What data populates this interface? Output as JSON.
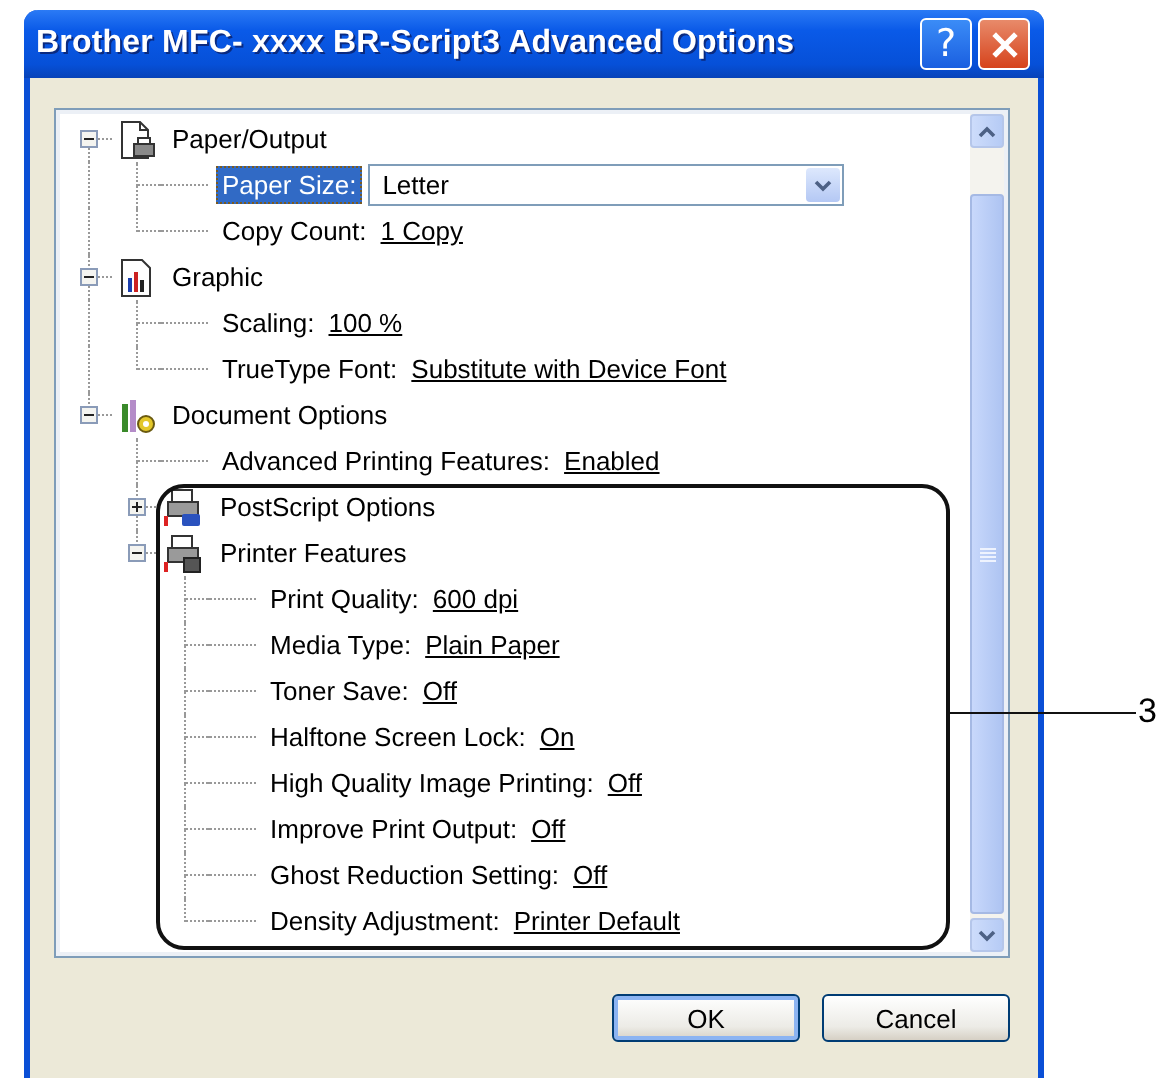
{
  "window": {
    "title": "Brother MFC- xxxx BR-Script3 Advanced Options",
    "help_button": "?"
  },
  "tree": [
    {
      "kind": "paper",
      "label": "Paper/Output",
      "expanded": true,
      "children": [
        {
          "kind": "dropdown",
          "label": "Paper Size:",
          "value": "Letter",
          "selected": true
        },
        {
          "kind": "setting",
          "label": "Copy Count:",
          "value": "1 Copy",
          "selected": false
        }
      ]
    },
    {
      "kind": "chart",
      "label": "Graphic",
      "expanded": true,
      "children": [
        {
          "kind": "setting",
          "label": "Scaling:",
          "value": "100 %",
          "selected": false
        },
        {
          "kind": "setting",
          "label": "TrueType Font:",
          "value": "Substitute with Device Font",
          "selected": false
        }
      ]
    },
    {
      "kind": "tools",
      "label": "Document Options",
      "expanded": true,
      "children": [
        {
          "kind": "setting",
          "label": "Advanced Printing Features:",
          "value": "Enabled",
          "selected": false
        },
        {
          "kind": "postscript",
          "label": "PostScript Options",
          "expanded": false
        },
        {
          "kind": "printer",
          "label": "Printer Features",
          "expanded": true,
          "children": [
            {
              "kind": "setting",
              "label": "Print Quality:",
              "value": "600 dpi",
              "selected": false
            },
            {
              "kind": "setting",
              "label": "Media Type:",
              "value": "Plain Paper",
              "selected": false
            },
            {
              "kind": "setting",
              "label": "Toner Save:",
              "value": "Off",
              "selected": false
            },
            {
              "kind": "setting",
              "label": "Halftone Screen Lock:",
              "value": "On",
              "selected": false
            },
            {
              "kind": "setting",
              "label": "High Quality Image Printing:",
              "value": "Off",
              "selected": false
            },
            {
              "kind": "setting",
              "label": "Improve Print Output:",
              "value": "Off",
              "selected": false
            },
            {
              "kind": "setting",
              "label": "Ghost Reduction Setting:",
              "value": "Off",
              "selected": false
            },
            {
              "kind": "setting",
              "label": "Density Adjustment:",
              "value": "Printer Default",
              "selected": false
            }
          ]
        }
      ]
    }
  ],
  "buttons": [
    {
      "label": "OK",
      "default": true
    },
    {
      "label": "Cancel",
      "default": false
    }
  ],
  "callout": {
    "label": "3"
  }
}
